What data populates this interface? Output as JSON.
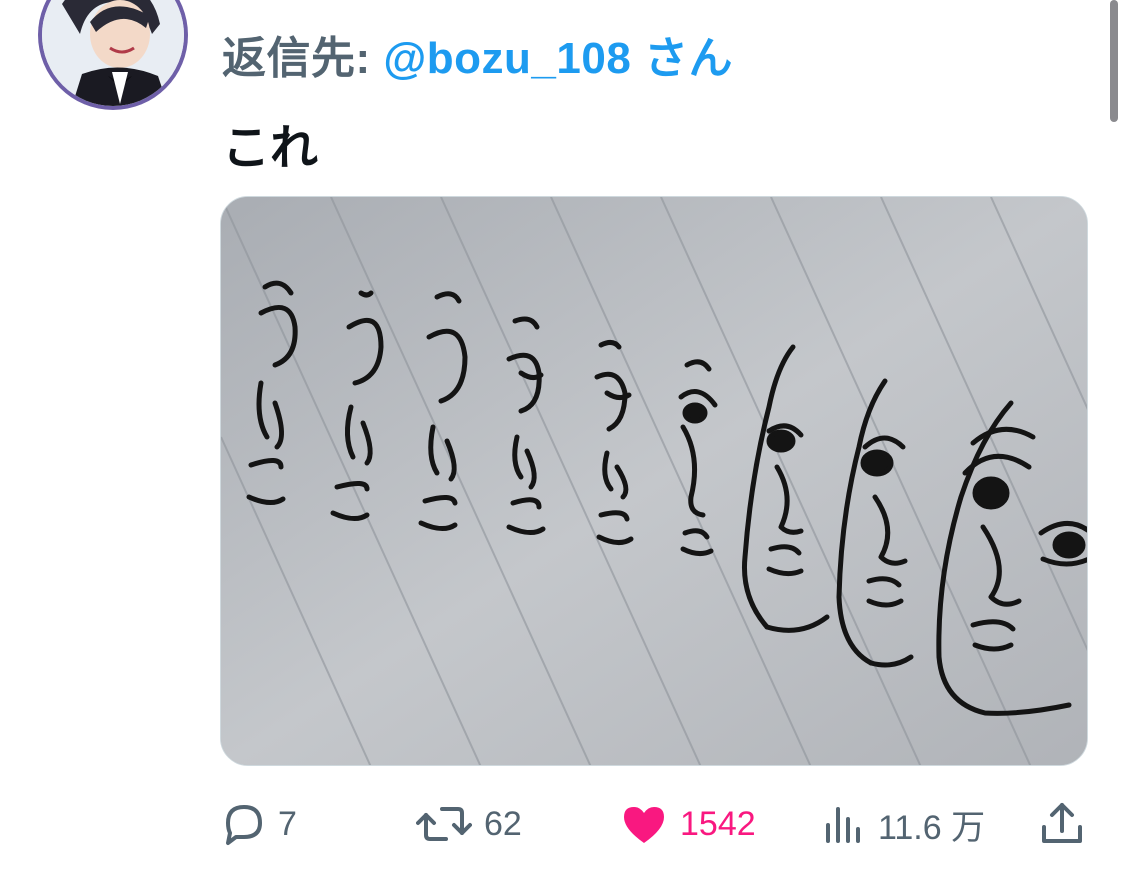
{
  "reply": {
    "prefix": "返信先: ",
    "handle": "@bozu_108",
    "suffix": " さん"
  },
  "tweet": {
    "text": "これ"
  },
  "media": {
    "icon": "photo-sketch"
  },
  "actions": {
    "reply_count": "7",
    "retweet_count": "62",
    "like_count": "1542",
    "views_count": "11.6 万"
  },
  "colors": {
    "accent": "#1d9bf0",
    "like": "#f91880",
    "muted": "#536471",
    "text": "#0f1419",
    "avatar_ring": "#6e5fa8"
  }
}
